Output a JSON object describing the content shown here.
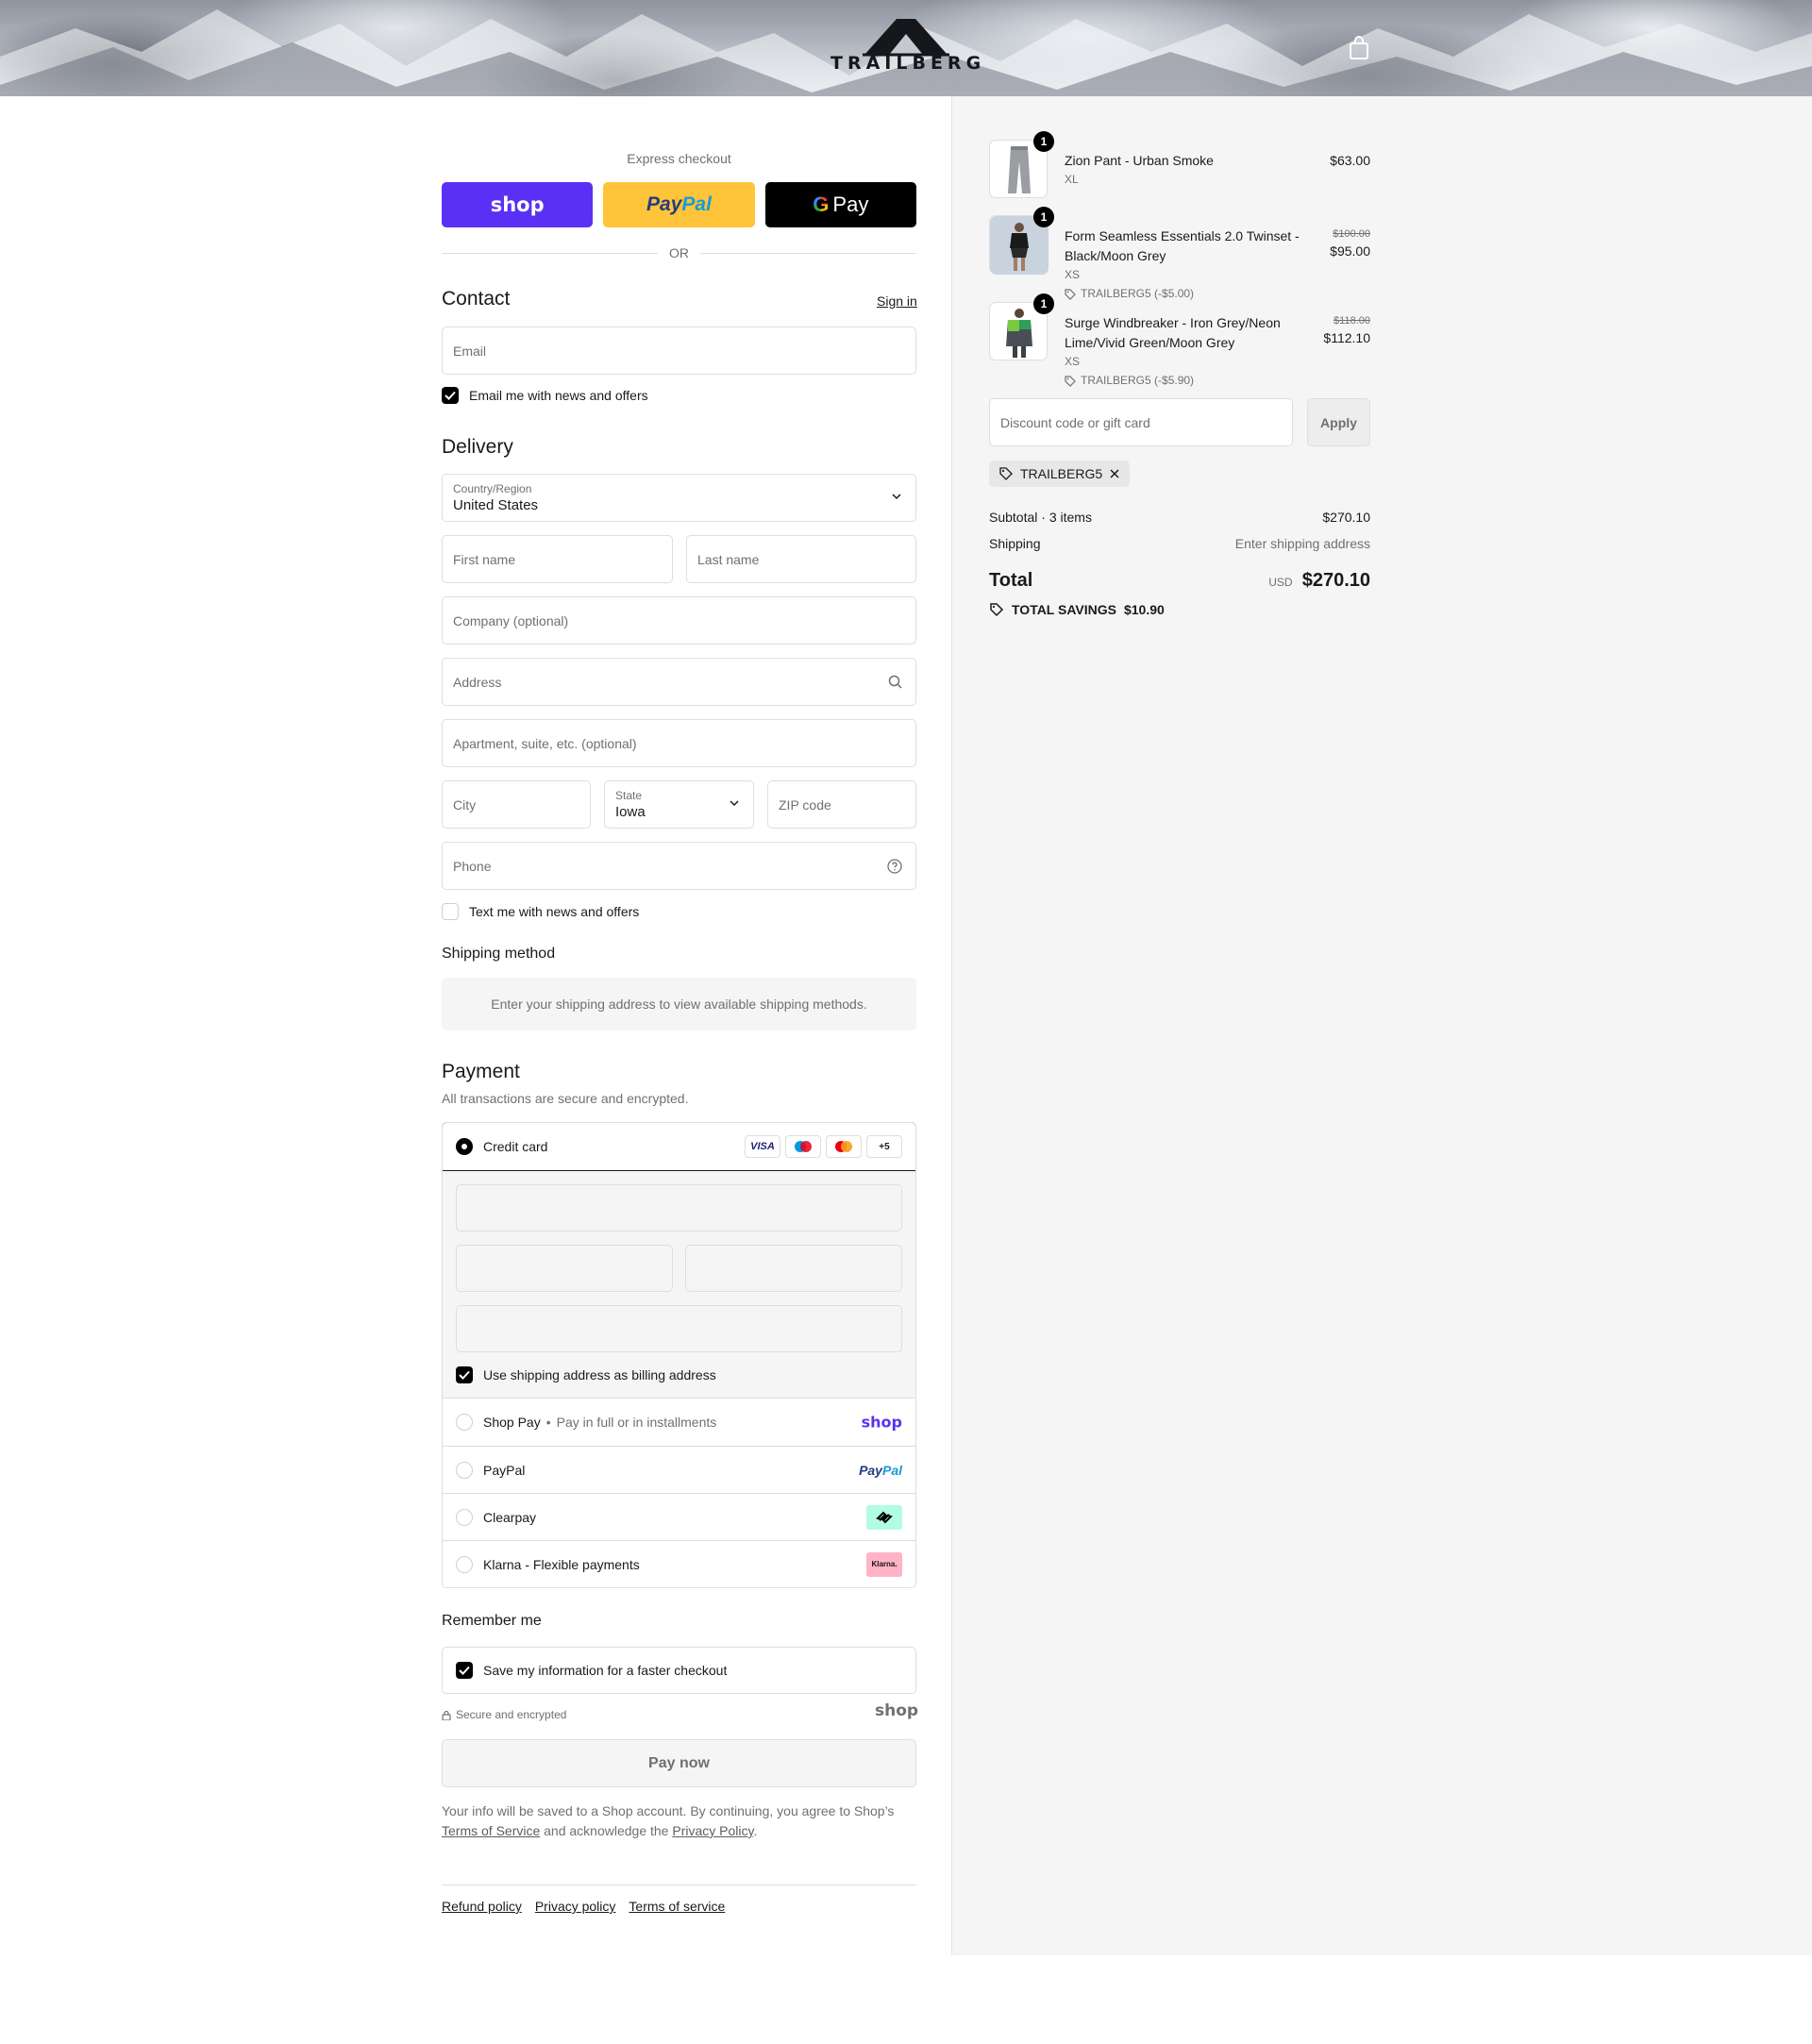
{
  "header": {
    "brand": "TRAILBERG",
    "cart_icon": "shopping-bag-icon"
  },
  "express": {
    "title": "Express checkout",
    "shop_label": "shop",
    "paypal_label_1": "Pay",
    "paypal_label_2": "Pal",
    "gpay_label": "Pay",
    "or_label": "OR"
  },
  "contact": {
    "heading": "Contact",
    "sign_in": "Sign in",
    "email_placeholder": "Email",
    "email_offers": "Email me with news and offers",
    "email_offers_checked": true
  },
  "delivery": {
    "heading": "Delivery",
    "country_label": "Country/Region",
    "country_value": "United States",
    "first_name_placeholder": "First name",
    "last_name_placeholder": "Last name",
    "company_placeholder": "Company (optional)",
    "address_placeholder": "Address",
    "apartment_placeholder": "Apartment, suite, etc. (optional)",
    "city_placeholder": "City",
    "state_label": "State",
    "state_value": "Iowa",
    "zip_placeholder": "ZIP code",
    "phone_placeholder": "Phone",
    "text_offers": "Text me with news and offers",
    "text_offers_checked": false
  },
  "shipping": {
    "heading": "Shipping method",
    "message": "Enter your shipping address to view available shipping methods."
  },
  "payment": {
    "heading": "Payment",
    "subtitle": "All transactions are secure and encrypted.",
    "credit_card_label": "Credit card",
    "card_more": "+5",
    "visa": "VISA",
    "billing_same": "Use shipping address as billing address",
    "billing_same_checked": true,
    "shop_pay_label": "Shop Pay",
    "shop_pay_sub": "Pay in full or in installments",
    "shop_logo": "shop",
    "paypal_label": "PayPal",
    "paypal_logo_1": "Pay",
    "paypal_logo_2": "Pal",
    "clearpay_label": "Clearpay",
    "klarna_label": "Klarna - Flexible payments",
    "klarna_logo": "Klarna."
  },
  "remember": {
    "heading": "Remember me",
    "save_info": "Save my information for a faster checkout",
    "save_info_checked": true,
    "secure": "Secure and encrypted",
    "shop_logo": "shop"
  },
  "pay_now": "Pay now",
  "legal": {
    "text_1": "Your info will be saved to a Shop account. By continuing, you agree to Shop’s ",
    "terms": "Terms of Service",
    "text_2": " and acknowledge the ",
    "privacy": "Privacy Policy",
    "text_3": "."
  },
  "footer": {
    "links": [
      "Refund policy",
      "Privacy policy",
      "Terms of service"
    ]
  },
  "summary": {
    "items": [
      {
        "name": "Zion Pant - Urban Smoke",
        "variant": "XL",
        "qty": "1",
        "price": "$63.00",
        "original_price": "",
        "discount": ""
      },
      {
        "name": "Form Seamless Essentials 2.0 Twinset - Black/Moon Grey",
        "variant": "XS",
        "qty": "1",
        "price": "$95.00",
        "original_price": "$100.00",
        "discount": "TRAILBERG5 (-$5.00)"
      },
      {
        "name": "Surge Windbreaker - Iron Grey/Neon Lime/Vivid Green/Moon Grey",
        "variant": "XS",
        "qty": "1",
        "price": "$112.10",
        "original_price": "$118.00",
        "discount": "TRAILBERG5 (-$5.90)"
      }
    ],
    "discount_placeholder": "Discount code or gift card",
    "apply_label": "Apply",
    "applied_code": "TRAILBERG5",
    "subtotal_label": "Subtotal · 3 items",
    "subtotal_value": "$270.10",
    "shipping_label": "Shipping",
    "shipping_value": "Enter shipping address",
    "total_label": "Total",
    "total_currency": "USD",
    "total_value": "$270.10",
    "savings_label": "TOTAL SAVINGS",
    "savings_value": "$10.90"
  },
  "colors": {
    "shop_purple": "#5a31f4",
    "paypal_yellow": "#ffc439",
    "summary_bg": "#f5f5f5"
  }
}
